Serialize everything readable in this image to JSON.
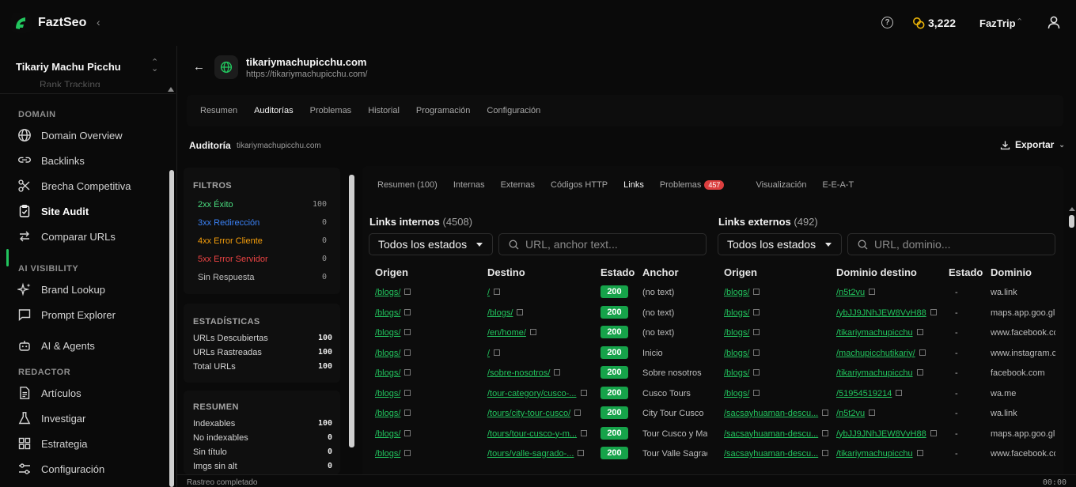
{
  "app": {
    "name": "FaztSeo",
    "credits": "3,222",
    "org": "FazTrip"
  },
  "sidebar": {
    "project": "Tikariy Machu Picchu",
    "cut_item": "Rank Tracking",
    "sections": {
      "domain": "DOMAIN",
      "ai_visibility": "AI VISIBILITY",
      "redactor": "REDACTOR"
    },
    "items": {
      "domain_overview": "Domain Overview",
      "backlinks": "Backlinks",
      "brecha": "Brecha Competitiva",
      "site_audit": "Site Audit",
      "comparar": "Comparar URLs",
      "brand_lookup": "Brand Lookup",
      "prompt_explorer": "Prompt Explorer",
      "ai_agents": "AI & Agents",
      "articulos": "Artículos",
      "investigar": "Investigar",
      "estrategia": "Estrategia",
      "configuracion": "Configuración"
    }
  },
  "site": {
    "name": "tikariymachupicchu.com",
    "url": "https://tikariymachupicchu.com/"
  },
  "top_tabs": [
    "Resumen",
    "Auditorías",
    "Problemas",
    "Historial",
    "Programación",
    "Configuración"
  ],
  "audit": {
    "title": "Auditoría",
    "domain": "tikariymachupicchu.com",
    "export": "Exportar"
  },
  "filters": {
    "title": "FILTROS",
    "rows": [
      {
        "label": "2xx Éxito",
        "value": "100",
        "color": "#4ade80"
      },
      {
        "label": "3xx Redirección",
        "value": "0",
        "color": "#3b82f6"
      },
      {
        "label": "4xx Error Cliente",
        "value": "0",
        "color": "#f59e0b"
      },
      {
        "label": "5xx Error Servidor",
        "value": "0",
        "color": "#ef4444"
      },
      {
        "label": "Sin Respuesta",
        "value": "0",
        "color": "#bdbdbd"
      }
    ]
  },
  "stats": {
    "title": "ESTADÍSTICAS",
    "rows": [
      {
        "label": "URLs Descubiertas",
        "value": "100"
      },
      {
        "label": "URLs Rastreadas",
        "value": "100"
      },
      {
        "label": "Total URLs",
        "value": "100"
      }
    ]
  },
  "summary": {
    "title": "RESUMEN",
    "rows": [
      {
        "label": "Indexables",
        "value": "100"
      },
      {
        "label": "No indexables",
        "value": "0"
      },
      {
        "label": "Sin título",
        "value": "0"
      },
      {
        "label": "Imgs sin alt",
        "value": "0"
      }
    ]
  },
  "sub_tabs": {
    "resumen": "Resumen (100)",
    "internas": "Internas",
    "externas": "Externas",
    "codigos": "Códigos HTTP",
    "links": "Links",
    "problemas": "Problemas",
    "problemas_count": "457",
    "visualizacion": "Visualización",
    "eeat": "E-E-A-T"
  },
  "internal": {
    "title": "Links internos",
    "count": "(4508)",
    "select": "Todos los estados",
    "search_placeholder": "URL, anchor text...",
    "headers": {
      "origen": "Origen",
      "destino": "Destino",
      "estado": "Estado",
      "anchor": "Anchor"
    },
    "rows": [
      {
        "origen": "/blogs/",
        "destino": "/",
        "estado": "200",
        "anchor": "(no text)"
      },
      {
        "origen": "/blogs/",
        "destino": "/blogs/",
        "estado": "200",
        "anchor": "(no text)"
      },
      {
        "origen": "/blogs/",
        "destino": "/en/home/",
        "estado": "200",
        "anchor": "(no text)"
      },
      {
        "origen": "/blogs/",
        "destino": "/",
        "estado": "200",
        "anchor": "Inicio"
      },
      {
        "origen": "/blogs/",
        "destino": "/sobre-nosotros/",
        "estado": "200",
        "anchor": "Sobre nosotros"
      },
      {
        "origen": "/blogs/",
        "destino": "/tour-category/cusco-...",
        "estado": "200",
        "anchor": "Cusco Tours"
      },
      {
        "origen": "/blogs/",
        "destino": "/tours/city-tour-cusco/",
        "estado": "200",
        "anchor": "City Tour Cusco"
      },
      {
        "origen": "/blogs/",
        "destino": "/tours/tour-cusco-y-m...",
        "estado": "200",
        "anchor": "Tour Cusco y Mac"
      },
      {
        "origen": "/blogs/",
        "destino": "/tours/valle-sagrado-...",
        "estado": "200",
        "anchor": "Tour Valle Sagrad"
      }
    ]
  },
  "external": {
    "title": "Links externos",
    "count": "(492)",
    "select": "Todos los estados",
    "search_placeholder": "URL, dominio...",
    "headers": {
      "origen": "Origen",
      "destino": "Dominio destino",
      "estado": "Estado",
      "dominio": "Dominio"
    },
    "rows": [
      {
        "origen": "/blogs/",
        "destino": "/n5t2vu",
        "estado": "-",
        "dominio": "wa.link"
      },
      {
        "origen": "/blogs/",
        "destino": "/ybJJ9JNhJEW8VvH88",
        "estado": "-",
        "dominio": "maps.app.goo.gl"
      },
      {
        "origen": "/blogs/",
        "destino": "/tikariymachupicchu",
        "estado": "-",
        "dominio": "www.facebook.co"
      },
      {
        "origen": "/blogs/",
        "destino": "/machupicchutikariy/",
        "estado": "-",
        "dominio": "www.instagram.c"
      },
      {
        "origen": "/blogs/",
        "destino": "/tikariymachupicchu",
        "estado": "-",
        "dominio": "facebook.com"
      },
      {
        "origen": "/blogs/",
        "destino": "/51954519214",
        "estado": "-",
        "dominio": "wa.me"
      },
      {
        "origen": "/sacsayhuaman-descu...",
        "destino": "/n5t2vu",
        "estado": "-",
        "dominio": "wa.link"
      },
      {
        "origen": "/sacsayhuaman-descu...",
        "destino": "/ybJJ9JNhJEW8VvH88",
        "estado": "-",
        "dominio": "maps.app.goo.gl"
      },
      {
        "origen": "/sacsayhuaman-descu...",
        "destino": "/tikariymachupicchu",
        "estado": "-",
        "dominio": "www.facebook.co"
      }
    ]
  },
  "statusbar": {
    "left": "Rastreo completado",
    "right": "00:00"
  },
  "colors": {
    "accent": "#22c55e",
    "badge_red": "#dc3f3f"
  },
  "icons": [
    "logo-icon",
    "help-icon",
    "coins-icon",
    "user-icon",
    "globe-icon",
    "download-icon",
    "search-icon",
    "external-link-icon"
  ]
}
